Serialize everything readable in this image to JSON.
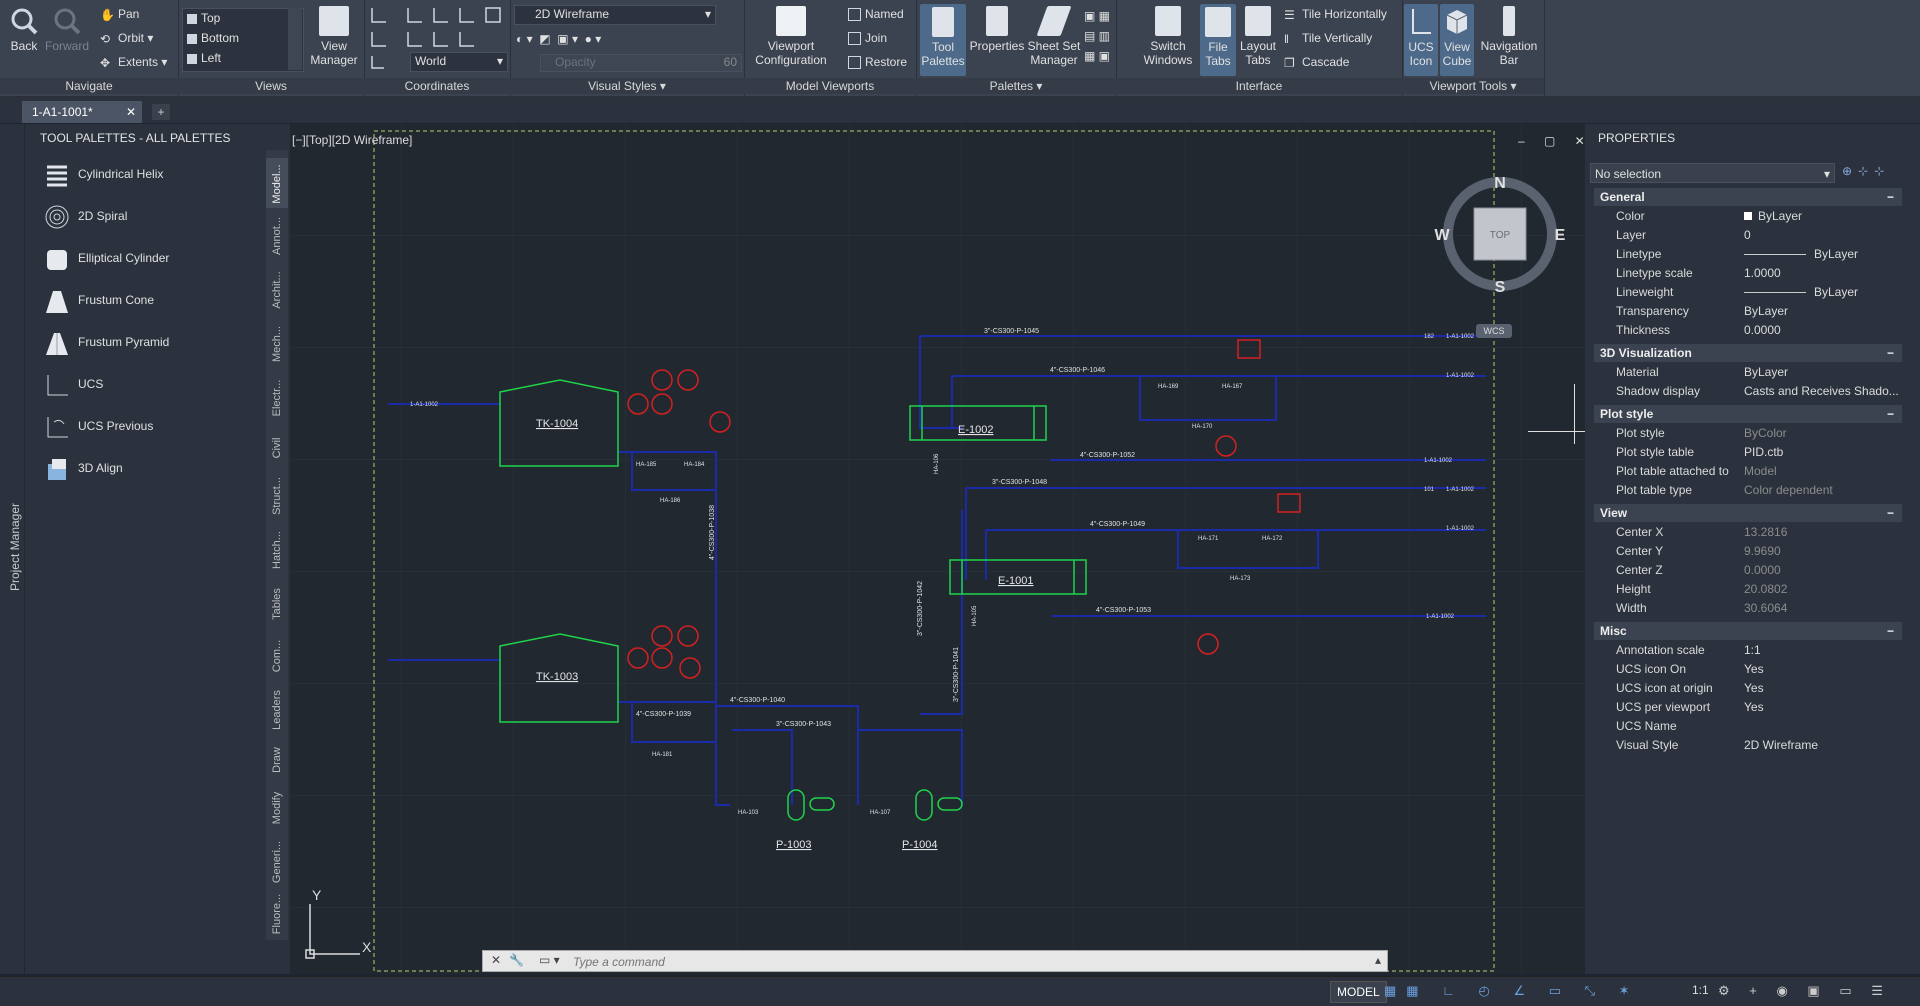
{
  "ribbon": {
    "navigate": {
      "title": "Navigate",
      "back": "Back",
      "forward": "Forward",
      "pan": "Pan",
      "orbit": "Orbit",
      "extents": "Extents"
    },
    "views": {
      "title": "Views",
      "items": [
        "Top",
        "Bottom",
        "Left"
      ],
      "view_manager": [
        "View",
        "Manager"
      ]
    },
    "coordinates": {
      "title": "Coordinates",
      "world": "World"
    },
    "visual_styles": {
      "title": "Visual Styles",
      "style": "2D Wireframe",
      "opacity_placeholder": "Opacity",
      "opacity_value": "60"
    },
    "model_viewports": {
      "title": "Model Viewports",
      "config": [
        "Viewport",
        "Configuration"
      ],
      "named": "Named",
      "join": "Join",
      "restore": "Restore"
    },
    "palettes": {
      "title": "Palettes",
      "tool_palettes": [
        "Tool",
        "Palettes"
      ],
      "properties": "Properties",
      "sheet_set": [
        "Sheet Set",
        "Manager"
      ]
    },
    "interface": {
      "title": "Interface",
      "switch_windows": [
        "Switch",
        "Windows"
      ],
      "file_tabs": [
        "File",
        "Tabs"
      ],
      "layout_tabs": [
        "Layout",
        "Tabs"
      ],
      "tile_h": "Tile Horizontally",
      "tile_v": "Tile Vertically",
      "cascade": "Cascade"
    },
    "viewport_tools": {
      "title": "Viewport Tools",
      "ucs_icon": [
        "UCS",
        "Icon"
      ],
      "view_cube": [
        "View",
        "Cube"
      ],
      "nav_bar": [
        "Navigation",
        "Bar"
      ]
    }
  },
  "tabs": {
    "doc": "1-A1-1001*",
    "new": "+"
  },
  "palette": {
    "title": "TOOL PALETTES - ALL PALETTES",
    "side_label": "Project Manager",
    "items": [
      "Cylindrical Helix",
      "2D Spiral",
      "Elliptical Cylinder",
      "Frustum Cone",
      "Frustum Pyramid",
      "UCS",
      "UCS Previous",
      "3D Align"
    ],
    "vtabs": [
      "Model...",
      "Annot...",
      "Archit...",
      "Mech...",
      "Electr...",
      "Civil",
      "Struct...",
      "Hatch...",
      "Tables",
      "Com...",
      "Leaders",
      "Draw",
      "Modify",
      "Generi...",
      "Fluore..."
    ]
  },
  "viewport": {
    "label": "[−][Top][2D Wireframe]",
    "controls": "– ▢ ✕",
    "compass": {
      "n": "N",
      "s": "S",
      "e": "E",
      "w": "W",
      "top": "TOP",
      "wcs": "WCS"
    },
    "ucs": {
      "x": "X",
      "y": "Y"
    }
  },
  "drawing": {
    "tanks": [
      "TK-1004",
      "TK-1003"
    ],
    "exchangers": [
      "E-1002",
      "E-1001"
    ],
    "pumps": [
      "P-1003",
      "P-1004"
    ],
    "lines": {
      "l1045": "3\"-CS300-P-1045",
      "l1046": "4\"-CS300-P-1046",
      "l1052": "4\"-CS300-P-1052",
      "l1048": "3\"-CS300-P-1048",
      "l1049": "4\"-CS300-P-1049",
      "l1053": "4\"-CS300-P-1053",
      "l1040": "4\"-CS300-P-1040",
      "l1043": "3\"-CS300-P-1043",
      "l1039": "4\"-CS300-P-1039",
      "l1038": "4\"-CS300-P-1038",
      "l1042": "3\"-CS300-P-1042",
      "l1041": "3\"-CS300-P-1041"
    },
    "valves": [
      "HA-185",
      "HA-184",
      "HA-186",
      "HA-181",
      "HA-103",
      "HA-107",
      "HA-169",
      "HA-167",
      "HA-170",
      "HA-171",
      "HA-172",
      "HA-173",
      "HA-106",
      "HA-105"
    ],
    "offpage_refs": [
      "182",
      "1-A1-1002",
      "1-A1-1002",
      "1-A1-1002",
      "101",
      "1-A1-1002",
      "1-A1-1002",
      "1-A1-1002",
      "1-A1-1002"
    ]
  },
  "cmdline": {
    "placeholder": "Type a command"
  },
  "properties": {
    "title": "PROPERTIES",
    "selection": "No selection",
    "sections": [
      {
        "name": "General",
        "rows": [
          [
            "Color",
            "ByLayer"
          ],
          [
            "Layer",
            "0"
          ],
          [
            "Linetype",
            "ByLayer"
          ],
          [
            "Linetype scale",
            "1.0000"
          ],
          [
            "Lineweight",
            "ByLayer"
          ],
          [
            "Transparency",
            "ByLayer"
          ],
          [
            "Thickness",
            "0.0000"
          ]
        ]
      },
      {
        "name": "3D Visualization",
        "rows": [
          [
            "Material",
            "ByLayer"
          ],
          [
            "Shadow display",
            "Casts and Receives Shado..."
          ]
        ]
      },
      {
        "name": "Plot style",
        "rows": [
          [
            "Plot style",
            "ByColor"
          ],
          [
            "Plot style table",
            "PID.ctb"
          ],
          [
            "Plot table attached to",
            "Model"
          ],
          [
            "Plot table type",
            "Color dependent"
          ]
        ]
      },
      {
        "name": "View",
        "rows": [
          [
            "Center X",
            "13.2816"
          ],
          [
            "Center Y",
            "9.9690"
          ],
          [
            "Center Z",
            "0.0000"
          ],
          [
            "Height",
            "20.0802"
          ],
          [
            "Width",
            "30.6064"
          ]
        ]
      },
      {
        "name": "Misc",
        "rows": [
          [
            "Annotation scale",
            "1:1"
          ],
          [
            "UCS icon On",
            "Yes"
          ],
          [
            "UCS icon at origin",
            "Yes"
          ],
          [
            "UCS per viewport",
            "Yes"
          ],
          [
            "UCS Name",
            ""
          ],
          [
            "Visual Style",
            "2D Wireframe"
          ]
        ]
      }
    ]
  },
  "status": {
    "model": "MODEL",
    "scale": "1:1"
  },
  "colors": {
    "pipe": "#1a2aa8",
    "equipment": "#1fd44a",
    "instrument": "#d42020",
    "frame": "#c8c86e",
    "grid": "#2b333e"
  }
}
